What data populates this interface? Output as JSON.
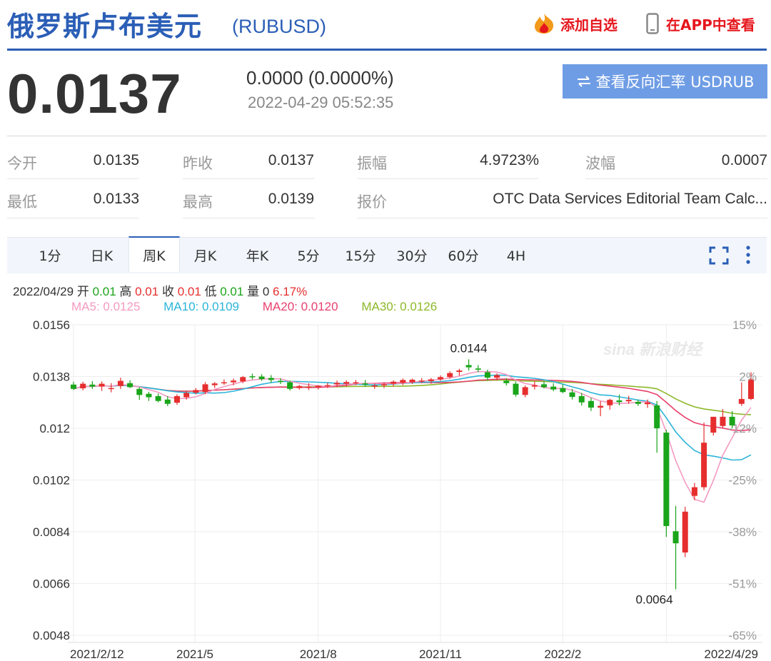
{
  "header": {
    "title": "俄罗斯卢布美元",
    "code": "(RUBUSD)",
    "add_fav": "添加自选",
    "view_app": "在APP中查看"
  },
  "quote": {
    "price": "0.0137",
    "change": "0.0000 (0.0000%)",
    "time": "2022-04-29 05:52:35",
    "reverse_button": "查看反向汇率 USDRUB"
  },
  "stats": [
    {
      "label": "今开",
      "value": "0.0135"
    },
    {
      "label": "昨收",
      "value": "0.0137"
    },
    {
      "label": "振幅",
      "value": "4.9723%"
    },
    {
      "label": "波幅",
      "value": "0.0007"
    },
    {
      "label": "最低",
      "value": "0.0133"
    },
    {
      "label": "最高",
      "value": "0.0139"
    },
    {
      "label": "报价",
      "value": "OTC Data Services Editorial Team Calc..."
    }
  ],
  "tabs": [
    "1分",
    "日K",
    "周K",
    "月K",
    "年K",
    "5分",
    "15分",
    "30分",
    "60分",
    "4H"
  ],
  "active_tab": "周K",
  "info": {
    "date": "2022/04/29",
    "open_label": "开",
    "open": "0.01",
    "high_label": "高",
    "high": "0.01",
    "close_label": "收",
    "close": "0.01",
    "low_label": "低",
    "low": "0.01",
    "vol_label": "量",
    "vol": "0",
    "pct": "6.17%"
  },
  "ma": {
    "ma5": "MA5: 0.0125",
    "ma10": "MA10: 0.0109",
    "ma20": "MA20: 0.0120",
    "ma30": "MA30: 0.0126"
  },
  "colors": {
    "brand": "#2b5eb6",
    "up": "#e62e2e",
    "down": "#1aa51a",
    "ma5": "#f49ac1",
    "ma10": "#2bb4d8",
    "ma20": "#e8406e",
    "ma30": "#8db82a",
    "button": "#6f9de5"
  },
  "chart_data": {
    "type": "candlestick",
    "y_ticks": [
      "0.0156",
      "0.0138",
      "0.012",
      "0.0102",
      "0.0084",
      "0.0066",
      "0.0048"
    ],
    "y_range": [
      0.0048,
      0.0156
    ],
    "pct_ticks": [
      "15%",
      "2%",
      "-12%",
      "-25%",
      "-38%",
      "-51%",
      "-65%"
    ],
    "x_ticks": [
      "2021/2/12",
      "2021/5",
      "2021/8",
      "2021/11",
      "2022/2",
      "2022/4/29"
    ],
    "annotations": [
      {
        "text": "0.0144",
        "value": 0.0144
      },
      {
        "text": "0.0064",
        "value": 0.0064
      }
    ],
    "watermark": "sina 新浪财经",
    "candles": [
      {
        "o": 0.01352,
        "h": 0.01362,
        "l": 0.01333,
        "c": 0.01337
      },
      {
        "o": 0.01339,
        "h": 0.01362,
        "l": 0.01332,
        "c": 0.01355
      },
      {
        "o": 0.01352,
        "h": 0.01364,
        "l": 0.01337,
        "c": 0.01345
      },
      {
        "o": 0.01345,
        "h": 0.01363,
        "l": 0.0133,
        "c": 0.01355
      },
      {
        "o": 0.0134,
        "h": 0.01357,
        "l": 0.01325,
        "c": 0.0134
      },
      {
        "o": 0.01347,
        "h": 0.01376,
        "l": 0.01337,
        "c": 0.01365
      },
      {
        "o": 0.01357,
        "h": 0.01367,
        "l": 0.0134,
        "c": 0.01343
      },
      {
        "o": 0.01337,
        "h": 0.01343,
        "l": 0.01299,
        "c": 0.01316
      },
      {
        "o": 0.0132,
        "h": 0.01327,
        "l": 0.01295,
        "c": 0.01308
      },
      {
        "o": 0.01312,
        "h": 0.01321,
        "l": 0.0129,
        "c": 0.01295
      },
      {
        "o": 0.013,
        "h": 0.01312,
        "l": 0.01277,
        "c": 0.01285
      },
      {
        "o": 0.01289,
        "h": 0.01318,
        "l": 0.01282,
        "c": 0.01312
      },
      {
        "o": 0.01308,
        "h": 0.01331,
        "l": 0.013,
        "c": 0.01323
      },
      {
        "o": 0.01324,
        "h": 0.0134,
        "l": 0.01318,
        "c": 0.01333
      },
      {
        "o": 0.01326,
        "h": 0.01361,
        "l": 0.01319,
        "c": 0.01353
      },
      {
        "o": 0.0135,
        "h": 0.01361,
        "l": 0.0134,
        "c": 0.01356
      },
      {
        "o": 0.01359,
        "h": 0.0137,
        "l": 0.01351,
        "c": 0.0136
      },
      {
        "o": 0.0136,
        "h": 0.01373,
        "l": 0.0135,
        "c": 0.01366
      },
      {
        "o": 0.01363,
        "h": 0.01382,
        "l": 0.01357,
        "c": 0.01378
      },
      {
        "o": 0.01381,
        "h": 0.0139,
        "l": 0.0137,
        "c": 0.0138
      },
      {
        "o": 0.0138,
        "h": 0.01388,
        "l": 0.01365,
        "c": 0.01371
      },
      {
        "o": 0.01375,
        "h": 0.01385,
        "l": 0.01358,
        "c": 0.01368
      },
      {
        "o": 0.01365,
        "h": 0.01374,
        "l": 0.01354,
        "c": 0.01362
      },
      {
        "o": 0.0136,
        "h": 0.01366,
        "l": 0.01331,
        "c": 0.01337
      },
      {
        "o": 0.0134,
        "h": 0.01351,
        "l": 0.01335,
        "c": 0.01347
      },
      {
        "o": 0.01344,
        "h": 0.01357,
        "l": 0.01333,
        "c": 0.01345
      },
      {
        "o": 0.01342,
        "h": 0.0135,
        "l": 0.01335,
        "c": 0.01348
      },
      {
        "o": 0.01346,
        "h": 0.01358,
        "l": 0.0134,
        "c": 0.0135
      },
      {
        "o": 0.01353,
        "h": 0.01366,
        "l": 0.01343,
        "c": 0.01358
      },
      {
        "o": 0.01355,
        "h": 0.01367,
        "l": 0.01345,
        "c": 0.01361
      },
      {
        "o": 0.01358,
        "h": 0.01368,
        "l": 0.0135,
        "c": 0.0136
      },
      {
        "o": 0.01356,
        "h": 0.01368,
        "l": 0.01344,
        "c": 0.01352
      },
      {
        "o": 0.01346,
        "h": 0.01356,
        "l": 0.01337,
        "c": 0.01349
      },
      {
        "o": 0.0135,
        "h": 0.0136,
        "l": 0.0134,
        "c": 0.01353
      },
      {
        "o": 0.01355,
        "h": 0.01367,
        "l": 0.01345,
        "c": 0.01362
      },
      {
        "o": 0.01358,
        "h": 0.01373,
        "l": 0.0135,
        "c": 0.01368
      },
      {
        "o": 0.0136,
        "h": 0.01373,
        "l": 0.01354,
        "c": 0.01369
      },
      {
        "o": 0.01364,
        "h": 0.01375,
        "l": 0.01357,
        "c": 0.01366
      },
      {
        "o": 0.01364,
        "h": 0.01375,
        "l": 0.01355,
        "c": 0.0137
      },
      {
        "o": 0.0137,
        "h": 0.01384,
        "l": 0.01365,
        "c": 0.01378
      },
      {
        "o": 0.01378,
        "h": 0.01398,
        "l": 0.01373,
        "c": 0.01392
      },
      {
        "o": 0.01396,
        "h": 0.01407,
        "l": 0.01383,
        "c": 0.01401
      },
      {
        "o": 0.0142,
        "h": 0.0144,
        "l": 0.01401,
        "c": 0.01412
      },
      {
        "o": 0.01408,
        "h": 0.0142,
        "l": 0.01395,
        "c": 0.01404
      },
      {
        "o": 0.01395,
        "h": 0.01404,
        "l": 0.01366,
        "c": 0.01376
      },
      {
        "o": 0.01376,
        "h": 0.01391,
        "l": 0.01366,
        "c": 0.01385
      },
      {
        "o": 0.01365,
        "h": 0.01374,
        "l": 0.01349,
        "c": 0.01357
      },
      {
        "o": 0.01355,
        "h": 0.01363,
        "l": 0.0131,
        "c": 0.01317
      },
      {
        "o": 0.01316,
        "h": 0.01349,
        "l": 0.01308,
        "c": 0.01343
      },
      {
        "o": 0.01345,
        "h": 0.01363,
        "l": 0.01335,
        "c": 0.0135
      },
      {
        "o": 0.01353,
        "h": 0.01363,
        "l": 0.01339,
        "c": 0.01343
      },
      {
        "o": 0.01345,
        "h": 0.01357,
        "l": 0.01329,
        "c": 0.01335
      },
      {
        "o": 0.0134,
        "h": 0.01353,
        "l": 0.01322,
        "c": 0.01326
      },
      {
        "o": 0.01325,
        "h": 0.01337,
        "l": 0.013,
        "c": 0.01309
      },
      {
        "o": 0.01312,
        "h": 0.01323,
        "l": 0.01279,
        "c": 0.0129
      },
      {
        "o": 0.01295,
        "h": 0.01306,
        "l": 0.0126,
        "c": 0.01272
      },
      {
        "o": 0.01272,
        "h": 0.01294,
        "l": 0.01242,
        "c": 0.01278
      },
      {
        "o": 0.0128,
        "h": 0.01303,
        "l": 0.01265,
        "c": 0.01299
      },
      {
        "o": 0.01297,
        "h": 0.01317,
        "l": 0.0128,
        "c": 0.01291
      },
      {
        "o": 0.01294,
        "h": 0.01313,
        "l": 0.01285,
        "c": 0.01299
      },
      {
        "o": 0.01292,
        "h": 0.013,
        "l": 0.01278,
        "c": 0.01285
      },
      {
        "o": 0.01284,
        "h": 0.013,
        "l": 0.01271,
        "c": 0.0129
      },
      {
        "o": 0.0128,
        "h": 0.01295,
        "l": 0.01115,
        "c": 0.012
      },
      {
        "o": 0.01185,
        "h": 0.01195,
        "l": 0.00822,
        "c": 0.0086
      },
      {
        "o": 0.00842,
        "h": 0.0093,
        "l": 0.0064,
        "c": 0.008
      },
      {
        "o": 0.00768,
        "h": 0.00927,
        "l": 0.00752,
        "c": 0.0091
      },
      {
        "o": 0.00965,
        "h": 0.0101,
        "l": 0.0095,
        "c": 0.00995
      },
      {
        "o": 0.00995,
        "h": 0.0122,
        "l": 0.00985,
        "c": 0.0115
      },
      {
        "o": 0.01185,
        "h": 0.0124,
        "l": 0.01175,
        "c": 0.0124
      },
      {
        "o": 0.01208,
        "h": 0.01267,
        "l": 0.012,
        "c": 0.0124
      },
      {
        "o": 0.0124,
        "h": 0.0126,
        "l": 0.012,
        "c": 0.0121
      },
      {
        "o": 0.01285,
        "h": 0.0136,
        "l": 0.01278,
        "c": 0.01302
      },
      {
        "o": 0.01302,
        "h": 0.01395,
        "l": 0.01298,
        "c": 0.0137
      }
    ]
  }
}
